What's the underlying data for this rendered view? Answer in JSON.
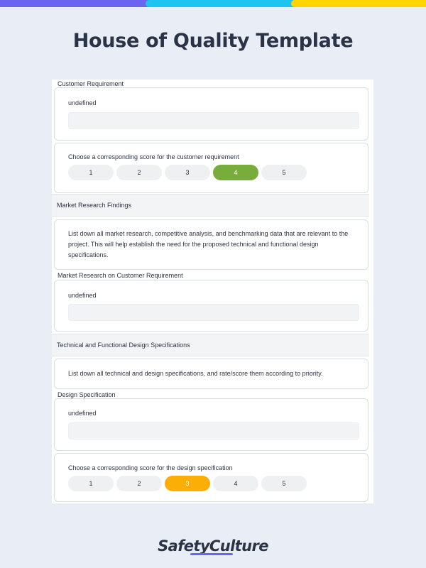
{
  "page": {
    "title": "House of Quality Template",
    "brand_colors": {
      "purple": "#6b64f0",
      "cyan": "#1ec4f0",
      "yellow": "#ffd400"
    }
  },
  "customer_requirement": {
    "label": "Customer Requirement",
    "value": "undefined",
    "score_prompt": "Choose a corresponding score for the customer requirement",
    "scores": [
      "1",
      "2",
      "3",
      "4",
      "5"
    ],
    "selected": "4",
    "selected_color": "#78ad3b"
  },
  "market_research": {
    "section_title": "Market Research Findings",
    "instructions": "List down all market research, competitive analysis, and benchmarking data that are relevant to the project. This will help establish the need for the proposed technical and functional design specifications.",
    "field_label": "Market Research on Customer Requirement",
    "value": "undefined"
  },
  "design_specs": {
    "section_title": "Technical and Functional Design Specifications",
    "instructions": "List down all technical and design specifications, and rate/score them according to priority.",
    "field_label": "Design Specification",
    "value": "undefined",
    "score_prompt": "Choose a corresponding score for the design specification",
    "scores": [
      "1",
      "2",
      "3",
      "4",
      "5"
    ],
    "selected": "3",
    "selected_color": "#fbae06"
  },
  "footer": {
    "logo_part_a": "Safety",
    "logo_part_b": "Culture"
  }
}
